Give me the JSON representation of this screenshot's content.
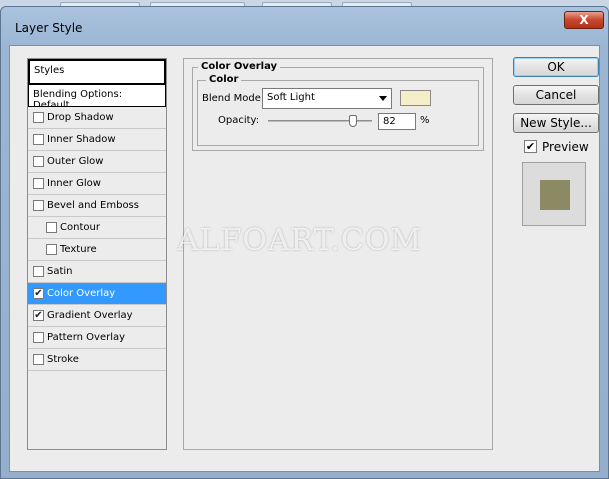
{
  "window": {
    "title": "Layer Style",
    "close_label": "X"
  },
  "styles_list": {
    "header": "Styles",
    "blending_options": "Blending Options: Default",
    "items": [
      {
        "label": "Drop Shadow",
        "checked": false,
        "sub": false,
        "selected": false
      },
      {
        "label": "Inner Shadow",
        "checked": false,
        "sub": false,
        "selected": false
      },
      {
        "label": "Outer Glow",
        "checked": false,
        "sub": false,
        "selected": false
      },
      {
        "label": "Inner Glow",
        "checked": false,
        "sub": false,
        "selected": false
      },
      {
        "label": "Bevel and Emboss",
        "checked": false,
        "sub": false,
        "selected": false
      },
      {
        "label": "Contour",
        "checked": false,
        "sub": true,
        "selected": false
      },
      {
        "label": "Texture",
        "checked": false,
        "sub": true,
        "selected": false
      },
      {
        "label": "Satin",
        "checked": false,
        "sub": false,
        "selected": false
      },
      {
        "label": "Color Overlay",
        "checked": true,
        "sub": false,
        "selected": true
      },
      {
        "label": "Gradient Overlay",
        "checked": true,
        "sub": false,
        "selected": false
      },
      {
        "label": "Pattern Overlay",
        "checked": false,
        "sub": false,
        "selected": false
      },
      {
        "label": "Stroke",
        "checked": false,
        "sub": false,
        "selected": false
      }
    ]
  },
  "color_overlay": {
    "section_title": "Color Overlay",
    "group_title": "Color",
    "blend_mode_label": "Blend Mode:",
    "blend_mode_value": "Soft Light",
    "swatch_color": "#f5efc9",
    "opacity_label": "Opacity:",
    "opacity_value": "82",
    "opacity_unit": "%",
    "opacity_fraction": 0.82
  },
  "buttons": {
    "ok": "OK",
    "cancel": "Cancel",
    "new_style": "New Style...",
    "preview_label": "Preview",
    "preview_checked": true,
    "preview_color": "#8c8a63"
  },
  "watermark": "ALFOART.COM",
  "check_glyph": "✔"
}
